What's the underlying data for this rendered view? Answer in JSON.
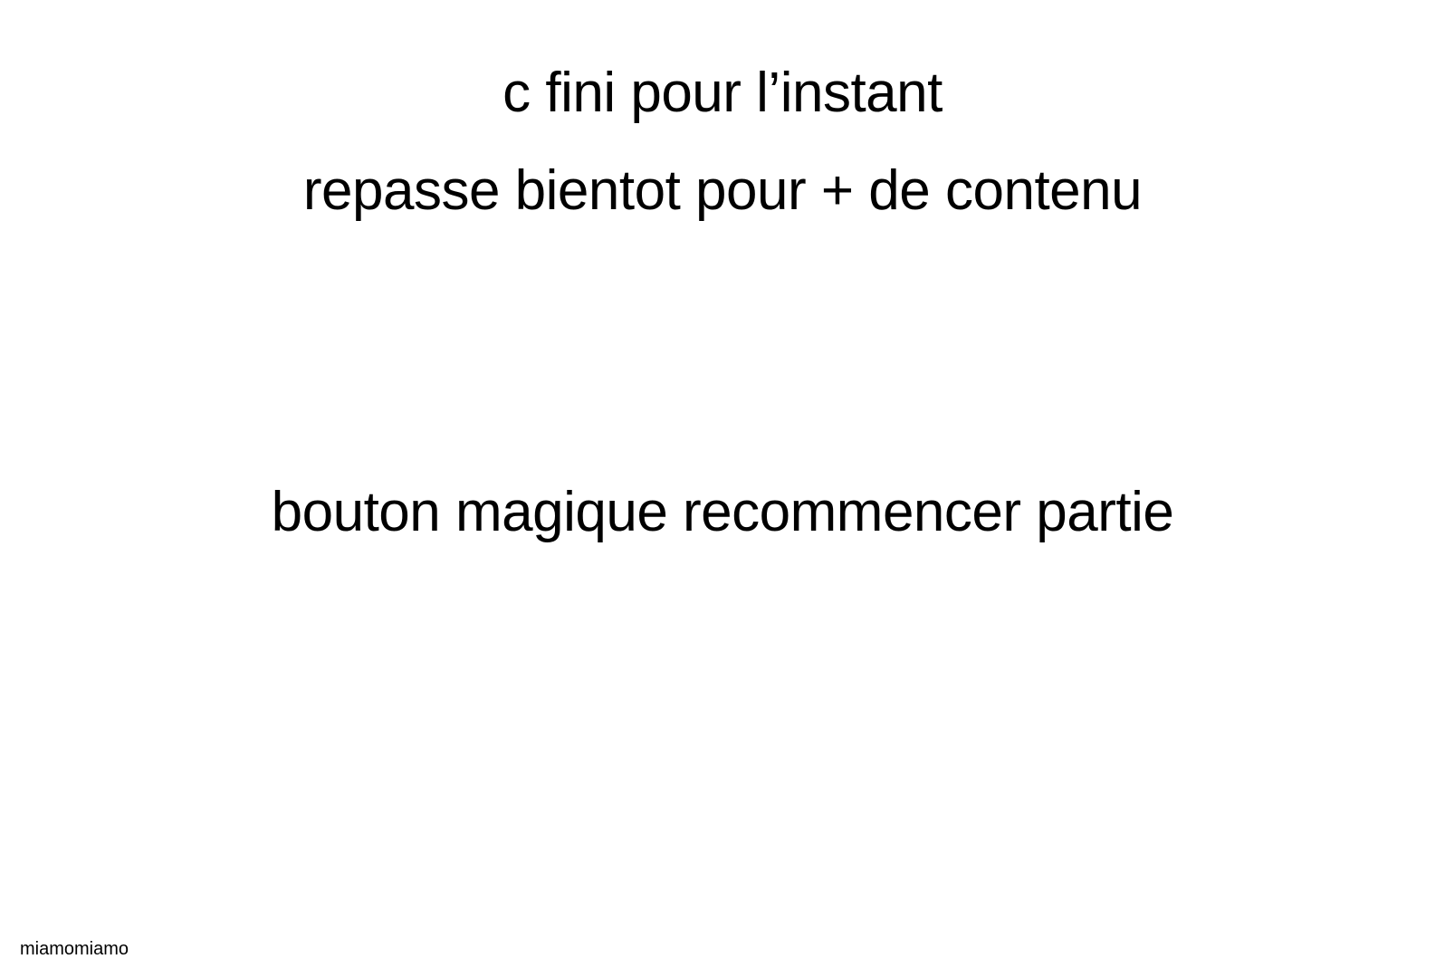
{
  "screen": {
    "message_line_1": "c fini pour l’instant",
    "message_line_2": "repasse bientot pour + de contenu",
    "restart_button_label": "bouton magique recommencer partie",
    "credit": "miamomiamo"
  },
  "colors": {
    "background": "#ffffff",
    "text": "#000000"
  }
}
